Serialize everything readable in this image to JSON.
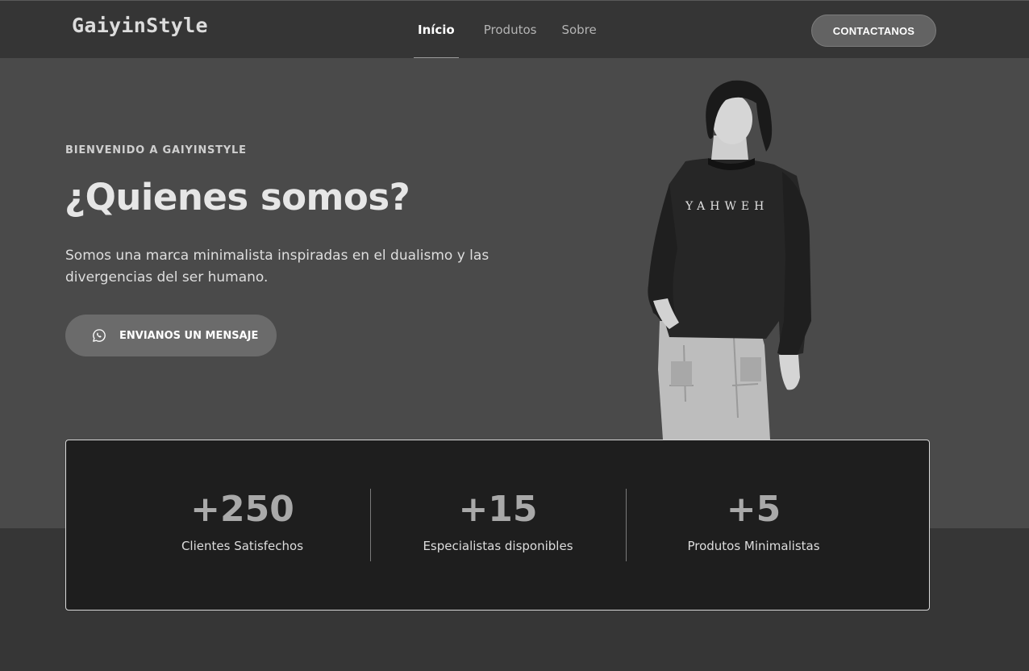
{
  "brand": {
    "logo": "GaiyinStyle"
  },
  "nav": {
    "items": [
      {
        "label": "Início",
        "active": true
      },
      {
        "label": "Produtos",
        "active": false
      },
      {
        "label": "Sobre",
        "active": false
      }
    ],
    "contact_label": "CONTACTANOS"
  },
  "hero": {
    "eyebrow": "BIENVENIDO A GAIYINSTYLE",
    "title": "¿Quienes somos?",
    "description": "Somos una marca minimalista inspiradas en el dualismo y las divergencias del ser humano.",
    "button_label": "ENVIANOS UN MENSAJE",
    "button_icon": "whatsapp-icon",
    "shirt_text": "YAHWEH"
  },
  "stats": [
    {
      "value": "+250",
      "label": "Clientes Satisfechos"
    },
    {
      "value": "+15",
      "label": "Especialistas disponibles"
    },
    {
      "value": "+5",
      "label": "Produtos Minimalistas"
    }
  ],
  "colors": {
    "navbar": "#353535",
    "hero_bg": "#4a4a4a",
    "page_bg": "#363636",
    "stats_bg": "#1e1e1e",
    "button": "#6b6b6b"
  }
}
